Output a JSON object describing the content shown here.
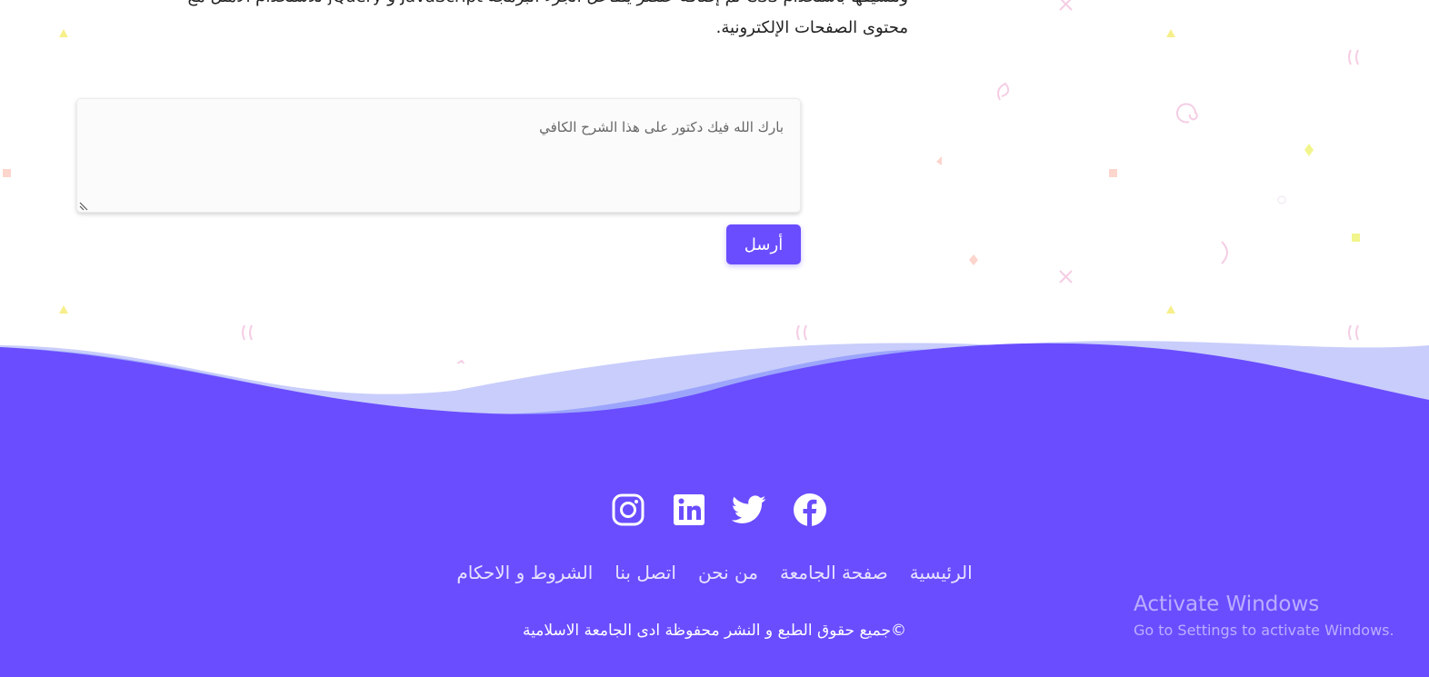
{
  "article": {
    "line1": "وتنسيقها باستخدام CSS ثم إضافة عنصر يتفاعل الجزء البرمجة JavaScript و jQuery للاستخدام الأمثل مع",
    "line2": "محتوى الصفحات الإلكترونية."
  },
  "comment": {
    "value": "بارك الله فيك دكتور على هذا الشرح الكافي",
    "send_label": "أرسل"
  },
  "colors": {
    "accent": "#6a4dff",
    "wave_light": "#c8cdfb",
    "wave_mid": "#9aa2fb"
  },
  "footer": {
    "social": [
      "facebook-icon",
      "twitter-icon",
      "linkedin-icon",
      "instagram-icon"
    ],
    "nav": [
      {
        "label": "الرئيسية"
      },
      {
        "label": "صفحة الجامعة"
      },
      {
        "label": "من نحن"
      },
      {
        "label": "اتصل بنا"
      },
      {
        "label": "الشروط و الاحكام"
      }
    ],
    "copyright": "©جميع حقوق الطبع و النشر محفوظة ادى الجامعة الاسلامية"
  },
  "watermark": {
    "title": "Activate Windows",
    "subtitle": "Go to Settings to activate Windows."
  }
}
